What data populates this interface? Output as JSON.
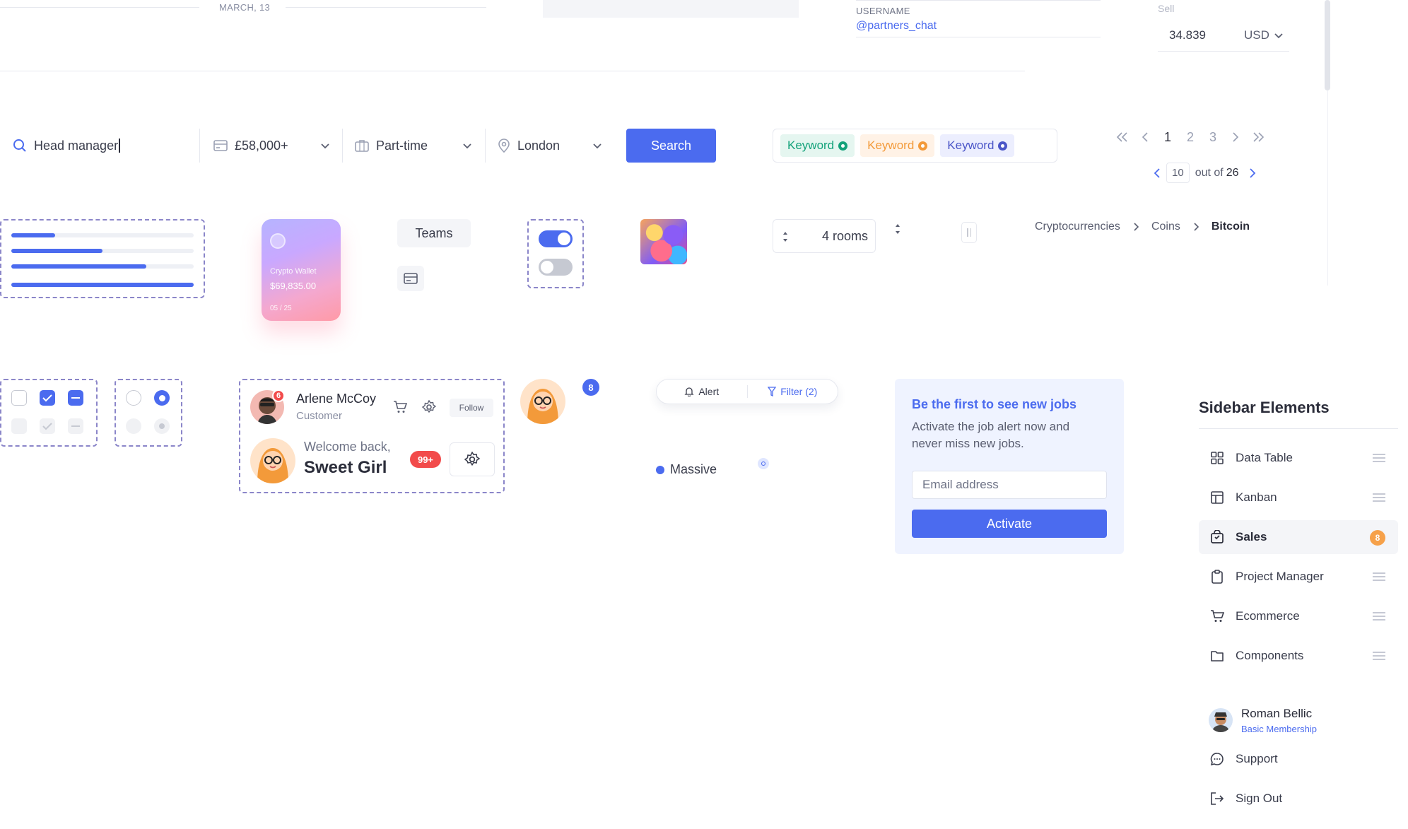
{
  "header": {
    "date": "MARCH, 13",
    "username_label": "USERNAME",
    "username": "@partners_chat",
    "sell_label": "Sell",
    "sell_value": "34.839",
    "currency": "USD"
  },
  "search": {
    "query": "Head manager",
    "salary": "£58,000+",
    "job_type": "Part-time",
    "location": "London",
    "button": "Search"
  },
  "keywords": [
    {
      "label": "Keyword",
      "color": "#13a27a",
      "bg": "#e5f6f0"
    },
    {
      "label": "Keyword",
      "color": "#f39a3a",
      "bg": "#fff2e6"
    },
    {
      "label": "Keyword",
      "color": "#4b56c8",
      "bg": "#eceefe"
    }
  ],
  "pagination": {
    "pages": [
      "1",
      "2",
      "3"
    ],
    "current": "10",
    "out_of": "out of",
    "total": "26"
  },
  "progress": [
    0.24,
    0.5,
    0.74,
    1.0
  ],
  "wallet": {
    "title": "Crypto Wallet",
    "amount": "$69,835.00",
    "expiry": "05 / 25"
  },
  "teams_button": "Teams",
  "stepper_value": "4 rooms",
  "breadcrumb": [
    "Cryptocurrencies",
    "Coins",
    "Bitcoin"
  ],
  "user_card": {
    "name": "Arlene McCoy",
    "role": "Customer",
    "notif": "6",
    "follow": "Follow",
    "welcome": "Welcome back,",
    "user": "Sweet Girl",
    "badge": "99+"
  },
  "avatar_badge": "8",
  "alert_bar": {
    "alert": "Alert",
    "filter": "Filter (2)"
  },
  "status_label": "Massive",
  "jobs": {
    "title": "Be the first to see new jobs",
    "desc": "Activate the job alert now and never miss new jobs.",
    "email_placeholder": "Email address",
    "button": "Activate"
  },
  "sidebar": {
    "title": "Sidebar Elements",
    "items": [
      {
        "label": "Data Table",
        "icon": "grid-icon"
      },
      {
        "label": "Kanban",
        "icon": "layout-icon"
      },
      {
        "label": "Sales",
        "icon": "bag-icon",
        "badge": "8"
      },
      {
        "label": "Project Manager",
        "icon": "clipboard-icon"
      },
      {
        "label": "Ecommerce",
        "icon": "cart-icon"
      },
      {
        "label": "Components",
        "icon": "folder-icon"
      }
    ],
    "profile_name": "Roman Bellic",
    "profile_plan": "Basic Membership",
    "support": "Support",
    "signout": "Sign Out"
  }
}
